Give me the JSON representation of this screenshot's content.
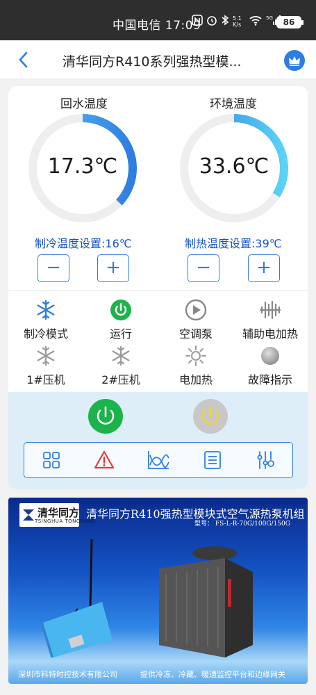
{
  "status_bar": {
    "carrier_time": "中国电信 17:09",
    "net_speed": "5.1 K/s",
    "battery": "86"
  },
  "header": {
    "title": "清华同方R410系列强热型模..."
  },
  "gauges": [
    {
      "title": "回水温度",
      "value": "17.3℃",
      "level": 0.37,
      "color": "#2f7de0"
    },
    {
      "title": "环境温度",
      "value": "33.6℃",
      "level": 0.34,
      "color": "#2f7de0"
    }
  ],
  "setpoints": {
    "cooling": "制冷温度设置:16℃",
    "heating": "制热温度设置:39℃",
    "minus": "−",
    "plus": "+"
  },
  "status_items": [
    {
      "label": "制冷模式",
      "icon": "snowflake-icon",
      "color": "#2f7de0"
    },
    {
      "label": "运行",
      "icon": "power-on-icon",
      "color": "#1bb34a"
    },
    {
      "label": "空调泵",
      "icon": "play-icon",
      "color": "#888888"
    },
    {
      "label": "辅助电加热",
      "icon": "heater-icon",
      "color": "#888888"
    },
    {
      "label": "1#压机",
      "icon": "snowflake-icon",
      "color": "#9a9a9a"
    },
    {
      "label": "2#压机",
      "icon": "snowflake-icon",
      "color": "#9a9a9a"
    },
    {
      "label": "电加热",
      "icon": "sun-icon",
      "color": "#9a9a9a"
    },
    {
      "label": "故障指示",
      "icon": "fault-indicator-icon",
      "color": "#9a9a9a"
    }
  ],
  "banner": {
    "logo_cn": "清华同方",
    "logo_en": "TSINGHUA TONGFANG",
    "title": "清华同方R410强热型模块式空气源热泵机组",
    "model": "型号： FS-L-R-70G/100G/150G",
    "footer_left": "深圳市科特时控技术有限公司",
    "footer_right": "提供冷冻、冷藏、暖通监控平台和边缘网关"
  },
  "colors": {
    "accent": "#2f7de0",
    "run_green": "#1bb34a",
    "panel_bg": "#ddeef8"
  }
}
